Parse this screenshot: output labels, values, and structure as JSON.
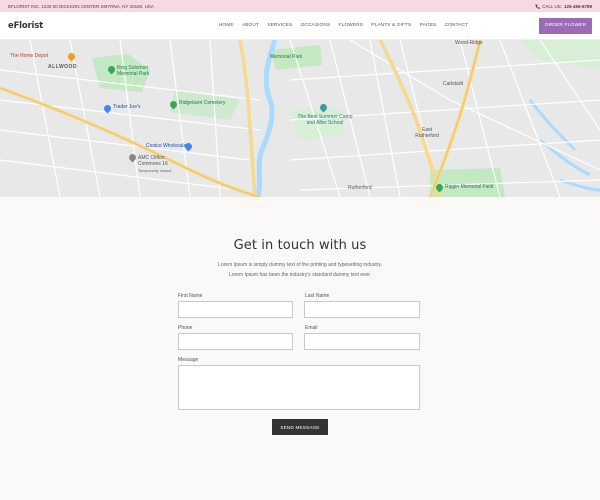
{
  "topbar": {
    "address": "EFLORIST INC. 1230 50 DICKSON CENTER SMYRNA, NY 20160, USA",
    "call_label": "CALL US:",
    "phone": "125-455-6789"
  },
  "header": {
    "logo": "eFlorist",
    "nav": [
      "HOME",
      "ABOUT",
      "SERVICES",
      "OCCASIONS",
      "FLOWERS",
      "PLANTS & GIFTS",
      "PAGES",
      "CONTACT"
    ],
    "order_button": "ORDER FLOWER"
  },
  "map": {
    "labels": {
      "home_depot": "The Home Depot",
      "allwood": "ALLWOOD",
      "king_solomon": "King Solomon Memorial Park",
      "trader_joes": "Trader Joe's",
      "ridgelawn": "Ridgelawn Cemetery",
      "costco": "Costco Wholesale",
      "amc": "AMC Clifton Commons 16",
      "amc_sub": "Temporarily closed",
      "memorial_park": "Memorial Park",
      "best_summer": "The Best Summer Camp and After School",
      "wood_ridge": "Wood-Ridge",
      "carlstadt": "Carlstadt",
      "east_rutherford": "East Rutherford",
      "rutherford": "Rutherford",
      "riggin": "Riggin Memorial Field"
    },
    "colors": {
      "land": "#e8e8e8",
      "road": "#ffffff",
      "highway": "#f6d98a",
      "water": "#aadaff",
      "park": "#c3e8c3"
    }
  },
  "contact": {
    "title": "Get in touch with us",
    "desc_line1": "Lorem Ipsum is simply dummy text of the printing and typesetting industry.",
    "desc_line2": "Lorem Ipsum has been the industry's standard dummy text ever.",
    "first_name_label": "First Name",
    "last_name_label": "Last Name",
    "phone_label": "Phone",
    "email_label": "Email",
    "message_label": "Message",
    "send_button": "SEND MESSAGE"
  },
  "colors": {
    "topbar_bg": "#f8d8e2",
    "accent": "#9b6cb3",
    "send_button_bg": "#333333",
    "section_bg": "#faf9f8"
  }
}
